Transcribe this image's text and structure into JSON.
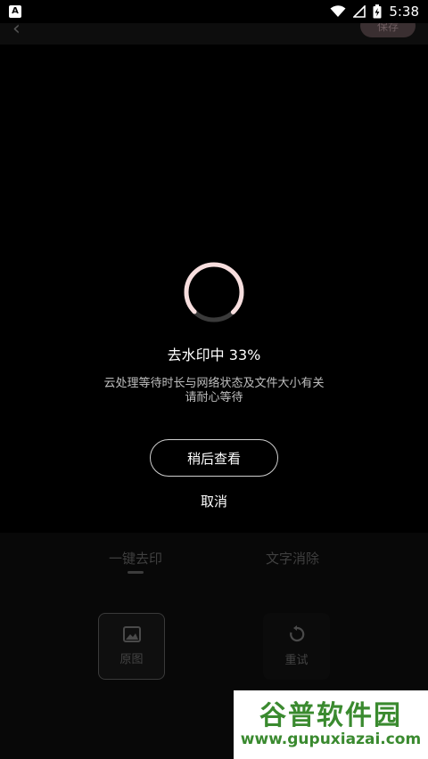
{
  "statusbar": {
    "time": "5:38",
    "notification_glyph": "A"
  },
  "topbar": {
    "save_label": "保存"
  },
  "dialog": {
    "progress_text": "去水印中 33%",
    "progress_fraction": 0.33,
    "desc_line1": "云处理等待时长与网络状态及文件大小有关",
    "desc_line2": "请耐心等待",
    "later_button": "稍后查看",
    "cancel_button": "取消"
  },
  "tabs": [
    {
      "label": "一键去印",
      "active": true
    },
    {
      "label": "文字消除",
      "active": false
    }
  ],
  "tools": [
    {
      "label": "原图",
      "icon": "image-icon"
    },
    {
      "label": "重试",
      "icon": "retry-icon"
    }
  ],
  "watermark": {
    "title": "谷普软件园",
    "url": "www.gupuxiazai.com"
  },
  "colors": {
    "spinner_arc": "#f7dede",
    "spinner_track": "#3a3a3a",
    "watermark_green": "#3a8a2f"
  }
}
